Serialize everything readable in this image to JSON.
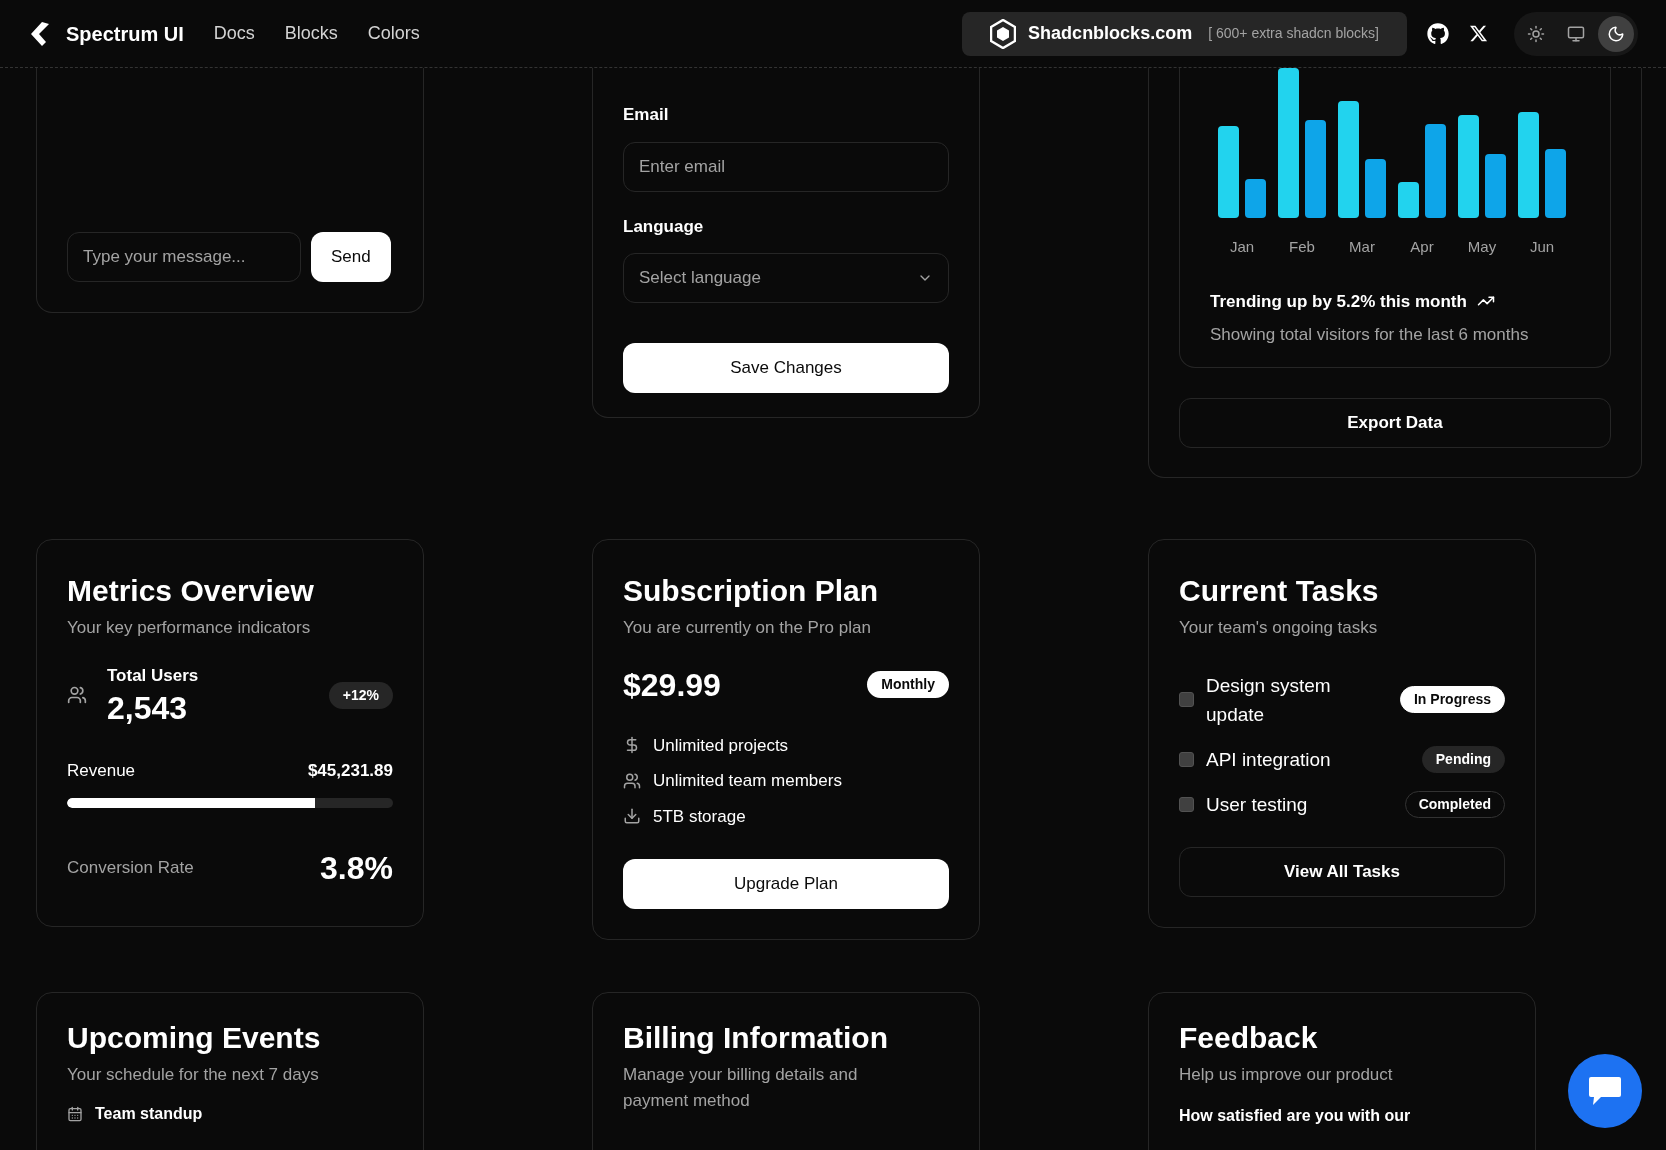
{
  "header": {
    "brand": "Spectrum UI",
    "nav": [
      "Docs",
      "Blocks",
      "Colors"
    ],
    "promo": {
      "name": "Shadcnblocks.com",
      "tagline": "[ 600+ extra shadcn blocks]"
    },
    "themes": [
      {
        "kind": "light",
        "selected": false
      },
      {
        "kind": "system",
        "selected": false
      },
      {
        "kind": "dark",
        "selected": true
      }
    ]
  },
  "chat_card": {
    "message": {
      "placeholder": "Type your message..."
    },
    "send": "Send"
  },
  "settings_card": {
    "fields": [
      {
        "kind": "input",
        "label": "Email",
        "placeholder": "Enter email"
      },
      {
        "kind": "select",
        "label": "Language",
        "placeholder": "Select language"
      }
    ],
    "save": "Save Changes"
  },
  "visitors_card": {
    "months": [
      "Jan",
      "Feb",
      "Mar",
      "Apr",
      "May",
      "Jun"
    ],
    "trend": "Trending up by 5.2% this month",
    "caption": "Showing total visitors for the last 6 months",
    "export": "Export Data"
  },
  "metrics": {
    "title": "Metrics Overview",
    "subtitle": "Your key performance indicators",
    "users_label": "Total Users",
    "users_value": "2,543",
    "users_change": "+12%",
    "revenue_label": "Revenue",
    "revenue_value": "$45,231.89",
    "level": 0.76,
    "conversion_label": "Conversion Rate",
    "conversion_value": "3.8%"
  },
  "subscription": {
    "title": "Subscription Plan",
    "subtitle": "You are currently on the Pro plan",
    "price": "$29.99",
    "period": "Monthly",
    "features": [
      {
        "kind": "dollar",
        "text": "Unlimited projects"
      },
      {
        "kind": "users",
        "text": "Unlimited team members"
      },
      {
        "kind": "download",
        "text": "5TB storage"
      }
    ],
    "button": "Upgrade Plan"
  },
  "tasks": {
    "title": "Current Tasks",
    "subtitle": "Your team's ongoing tasks",
    "items": [
      {
        "text": "Design system update",
        "checked": false,
        "status": "In Progress",
        "kind": "solid"
      },
      {
        "text": "API integration",
        "checked": false,
        "status": "Pending",
        "kind": "muted"
      },
      {
        "text": "User testing",
        "checked": false,
        "status": "Completed",
        "kind": "outline"
      }
    ],
    "button": "View All Tasks"
  },
  "events": {
    "title": "Upcoming Events",
    "subtitle": "Your schedule for the next 7 days",
    "items": [
      "Team standup"
    ]
  },
  "billing": {
    "title": "Billing Information",
    "subtitle": "Manage your billing details and payment method"
  },
  "feedback": {
    "title": "Feedback",
    "subtitle": "Help us improve our product",
    "question": "How satisfied are you with our"
  }
}
